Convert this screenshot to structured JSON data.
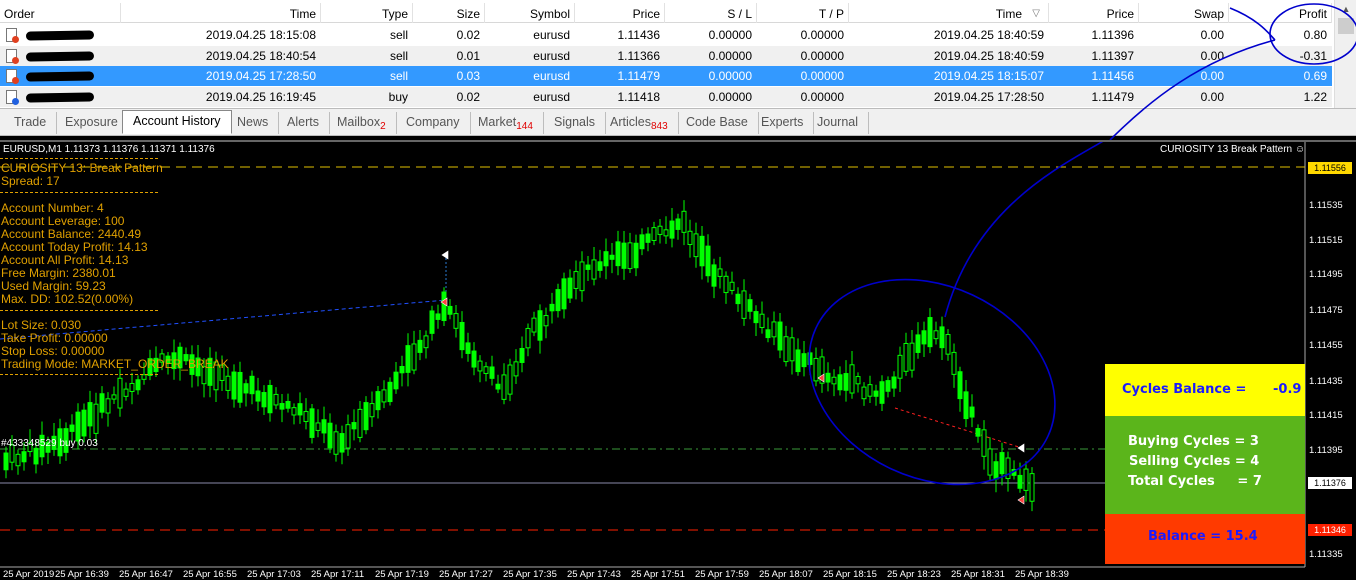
{
  "columns": [
    "Order",
    "Time",
    "Type",
    "Size",
    "Symbol",
    "Price",
    "S / L",
    "T / P",
    "Time",
    "Price",
    "Swap",
    "Profit"
  ],
  "sort_indicator": "▽",
  "orders": [
    {
      "time": "2019.04.25 18:15:08",
      "type": "sell",
      "size": "0.02",
      "symbol": "eurusd",
      "price": "1.11436",
      "sl": "0.00000",
      "tp": "0.00000",
      "close_time": "2019.04.25 18:40:59",
      "close_price": "1.11396",
      "swap": "0.00",
      "profit": "0.80",
      "icon": "sell-order-icon"
    },
    {
      "time": "2019.04.25 18:40:54",
      "type": "sell",
      "size": "0.01",
      "symbol": "eurusd",
      "price": "1.11366",
      "sl": "0.00000",
      "tp": "0.00000",
      "close_time": "2019.04.25 18:40:59",
      "close_price": "1.11397",
      "swap": "0.00",
      "profit": "-0.31",
      "icon": "sell-order-icon"
    },
    {
      "time": "2019.04.25 17:28:50",
      "type": "sell",
      "size": "0.03",
      "symbol": "eurusd",
      "price": "1.11479",
      "sl": "0.00000",
      "tp": "0.00000",
      "close_time": "2019.04.25 18:15:07",
      "close_price": "1.11456",
      "swap": "0.00",
      "profit": "0.69",
      "icon": "sell-order-icon"
    },
    {
      "time": "2019.04.25 16:19:45",
      "type": "buy",
      "size": "0.02",
      "symbol": "eurusd",
      "price": "1.11418",
      "sl": "0.00000",
      "tp": "0.00000",
      "close_time": "2019.04.25 17:28:50",
      "close_price": "1.11479",
      "swap": "0.00",
      "profit": "1.22",
      "icon": "buy-order-icon"
    }
  ],
  "tabs": [
    {
      "label": "Trade",
      "badge": ""
    },
    {
      "label": "Exposure",
      "badge": ""
    },
    {
      "label": "Account History",
      "badge": ""
    },
    {
      "label": "News",
      "badge": ""
    },
    {
      "label": "Alerts",
      "badge": ""
    },
    {
      "label": "Mailbox",
      "badge": "2"
    },
    {
      "label": "Company",
      "badge": ""
    },
    {
      "label": "Market",
      "badge": "144"
    },
    {
      "label": "Signals",
      "badge": ""
    },
    {
      "label": "Articles",
      "badge": "843"
    },
    {
      "label": "Code Base",
      "badge": ""
    },
    {
      "label": "Experts",
      "badge": ""
    },
    {
      "label": "Journal",
      "badge": ""
    }
  ],
  "chart": {
    "symbol_header": "EURUSD,M1  1.11373 1.11376 1.11371 1.11376",
    "expert_name": "CURIOSITY 13 Break Pattern ☺",
    "info_lines": [
      "CURIOSITY 13: Break Pattern",
      "Spread: 17",
      "Account Number: 4",
      "Account Leverage: 100",
      "Account Balance: 2440.49",
      "Account Today Profit: 14.13",
      "Account All Profit: 14.13",
      "Free Margin: 2380.01",
      "Used Margin: 59.23",
      "Max. DD: 102.52(0.00%)",
      "Lot Size: 0.030",
      "Take Profit: 0.00000",
      "Stop Loss: 0.00000",
      "Trading Mode: MARKET_ORDER_BREAK"
    ],
    "order_label": "#433348529 buy 0.03",
    "price_ticks": [
      "1.11535",
      "1.11515",
      "1.11495",
      "1.11475",
      "1.11455",
      "1.11435",
      "1.11415",
      "1.11395",
      "1.11355",
      "1.11335"
    ],
    "price_tags": {
      "top": "1.11556",
      "current": "1.11376",
      "bottom": "1.11346"
    },
    "time_ticks": [
      "25 Apr 2019",
      "25 Apr 16:39",
      "25 Apr 16:47",
      "25 Apr 16:55",
      "25 Apr 17:03",
      "25 Apr 17:11",
      "25 Apr 17:19",
      "25 Apr 17:27",
      "25 Apr 17:35",
      "25 Apr 17:43",
      "25 Apr 17:51",
      "25 Apr 17:59",
      "25 Apr 18:07",
      "25 Apr 18:15",
      "25 Apr 18:23",
      "25 Apr 18:31",
      "25 Apr 18:39"
    ],
    "candle_color": "#00ff00",
    "annotation_color": "#0000cc"
  },
  "panel": {
    "cycles_balance_label": "Cycles Balance =",
    "cycles_balance_value": "-0.9",
    "buying_cycles": "Buying Cycles = 3",
    "selling_cycles": "Selling Cycles = 4",
    "total_cycles": "Total Cycles     = 7",
    "balance": "Balance = 15.4"
  }
}
